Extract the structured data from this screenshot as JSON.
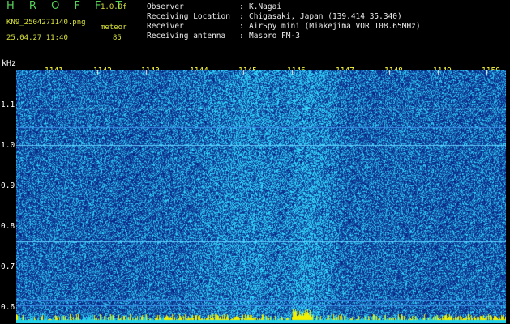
{
  "header": {
    "brand": "H R O F F T",
    "version": "1.0.0f",
    "filename": "KN9_2504271140.png",
    "meteor_label": "meteor",
    "datetime": "25.04.27 11:40",
    "count": "85"
  },
  "info": [
    {
      "key": "Observer",
      "value": "K.Nagai"
    },
    {
      "key": "Receiving Location",
      "value": "Chigasaki, Japan (139.414 35.340)"
    },
    {
      "key": "Receiver",
      "value": "AirSpy mini (Miakejima VOR 108.65MHz)"
    },
    {
      "key": "Receiving antenna",
      "value": "Maspro FM-3"
    }
  ],
  "info_sep": ":",
  "axis": {
    "y_unit": "kHz",
    "y_ticks": [
      "1.1",
      "1.0",
      "0.9",
      "0.8",
      "0.7",
      "0.6"
    ],
    "x_ticks": [
      "1141",
      "1142",
      "1143",
      "1144",
      "1145",
      "1146",
      "1147",
      "1148",
      "1149",
      "1150"
    ]
  },
  "colors": {
    "background": "#000000",
    "waterfall_base": "#0a1f8a",
    "noise_bright": "#2fc8ff",
    "tick_label": "#ffff44",
    "header_yellow": "#d8e23a",
    "brand_green": "#58d35a"
  }
}
